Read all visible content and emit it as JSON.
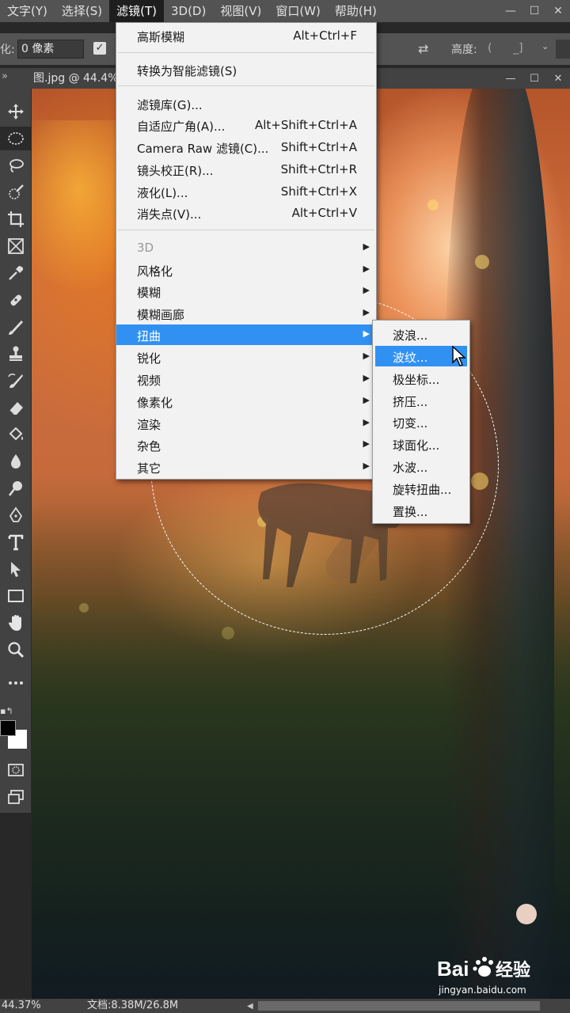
{
  "menubar": {
    "items": [
      {
        "label": "文字(Y)"
      },
      {
        "label": "选择(S)"
      },
      {
        "label": "滤镜(T)"
      },
      {
        "label": "3D(D)"
      },
      {
        "label": "视图(V)"
      },
      {
        "label": "窗口(W)"
      },
      {
        "label": "帮助(H)"
      }
    ],
    "active_index": 2
  },
  "options_bar": {
    "feather_label": "化:",
    "feather_value": "0 像素",
    "height_label": "高度:"
  },
  "document": {
    "tab_label": "图.jpg @ 44.4%"
  },
  "filter_menu": {
    "items": [
      {
        "label": "高斯模糊",
        "shortcut": "Alt+Ctrl+F"
      },
      {
        "label": "转换为智能滤镜(S)",
        "shortcut": ""
      },
      {
        "label": "滤镜库(G)...",
        "shortcut": ""
      },
      {
        "label": "自适应广角(A)...",
        "shortcut": "Alt+Shift+Ctrl+A"
      },
      {
        "label": "Camera Raw 滤镜(C)...",
        "shortcut": "Shift+Ctrl+A"
      },
      {
        "label": "镜头校正(R)...",
        "shortcut": "Shift+Ctrl+R"
      },
      {
        "label": "液化(L)...",
        "shortcut": "Shift+Ctrl+X"
      },
      {
        "label": "消失点(V)...",
        "shortcut": "Alt+Ctrl+V"
      },
      {
        "label": "3D",
        "submenu": true,
        "disabled": true
      },
      {
        "label": "风格化",
        "submenu": true
      },
      {
        "label": "模糊",
        "submenu": true
      },
      {
        "label": "模糊画廊",
        "submenu": true
      },
      {
        "label": "扭曲",
        "submenu": true,
        "highlighted": true
      },
      {
        "label": "锐化",
        "submenu": true
      },
      {
        "label": "视频",
        "submenu": true
      },
      {
        "label": "像素化",
        "submenu": true
      },
      {
        "label": "渲染",
        "submenu": true
      },
      {
        "label": "杂色",
        "submenu": true
      },
      {
        "label": "其它",
        "submenu": true
      }
    ]
  },
  "distort_submenu": {
    "items": [
      {
        "label": "波浪..."
      },
      {
        "label": "波纹...",
        "highlighted": true
      },
      {
        "label": "极坐标..."
      },
      {
        "label": "挤压..."
      },
      {
        "label": "切变..."
      },
      {
        "label": "球面化..."
      },
      {
        "label": "水波..."
      },
      {
        "label": "旋转扭曲..."
      },
      {
        "label": "置换..."
      }
    ]
  },
  "status_bar": {
    "zoom": "44.37%",
    "doc_info": "文档:8.38M/26.8M"
  },
  "watermark": {
    "logo_text": "Bai 经验",
    "url": "jingyan.baidu.com"
  },
  "colors": {
    "menu_highlight": "#3091f2",
    "menu_bg": "#f2f2f2",
    "chrome_dark": "#424242",
    "chrome_mid": "#535353"
  }
}
